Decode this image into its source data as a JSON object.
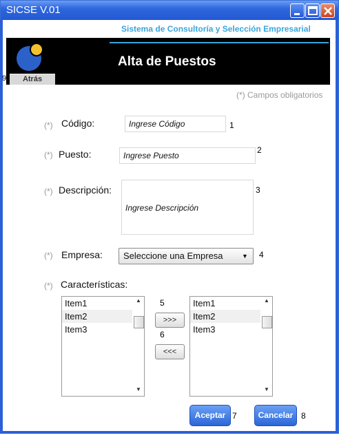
{
  "window": {
    "title": "SICSE V.01"
  },
  "header": {
    "company": "Sistema de Consultoría y Selección Empresarial",
    "page_title": "Alta de Puestos",
    "back_label": "Atrás",
    "back_number": "9"
  },
  "form": {
    "required_note": "(*) Campos obligatorios",
    "required_mark": "(*)",
    "codigo": {
      "label": "Código:",
      "placeholder": "Ingrese Código",
      "number": "1"
    },
    "puesto": {
      "label": "Puesto:",
      "placeholder": "Ingrese Puesto",
      "number": "2"
    },
    "descripcion": {
      "label": "Descripción:",
      "placeholder": "Ingrese Descripción",
      "number": "3"
    },
    "empresa": {
      "label": "Empresa:",
      "selected": "Seleccione una Empresa",
      "number": "4"
    },
    "caracteristicas": {
      "label": "Características:",
      "left_items": [
        "Item1",
        "Item2",
        "Item3"
      ],
      "right_items": [
        "Item1",
        "Item2",
        "Item3"
      ],
      "add_label": ">>>",
      "add_number": "5",
      "remove_label": "<<<",
      "remove_number": "6"
    }
  },
  "actions": {
    "accept_label": "Aceptar",
    "accept_number": "7",
    "cancel_label": "Cancelar",
    "cancel_number": "8"
  },
  "colors": {
    "titlebar": "#2f67de",
    "accent": "#3aa5dc",
    "button": "#2b66d8"
  }
}
